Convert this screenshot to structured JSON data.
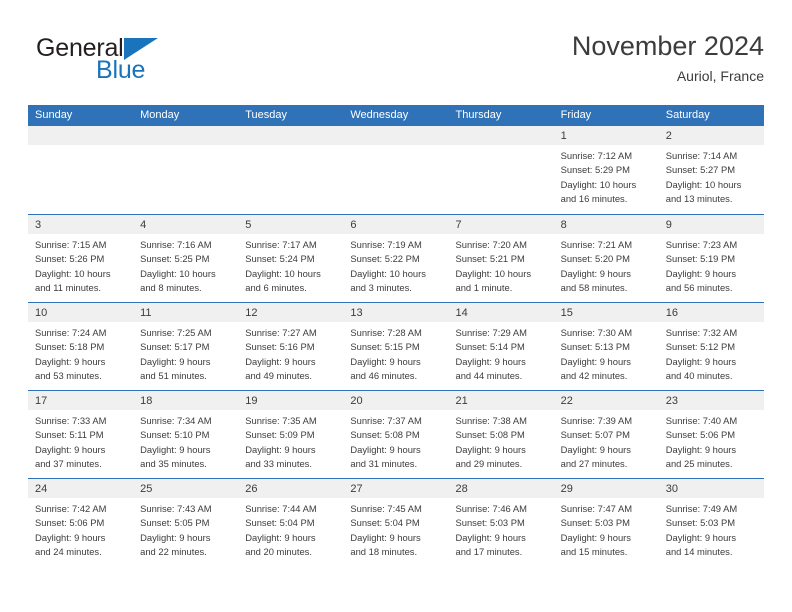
{
  "brand": {
    "name_part1": "General",
    "name_part2": "Blue",
    "triangle_icon": "triangle-icon",
    "accent_color": "#1a74bb"
  },
  "header": {
    "title": "November 2024",
    "subtitle": "Auriol, France"
  },
  "theme": {
    "header_blue": "#2f72b8",
    "band_gray": "#f0f0f0",
    "text": "#3c3c3c"
  },
  "weekdays": [
    "Sunday",
    "Monday",
    "Tuesday",
    "Wednesday",
    "Thursday",
    "Friday",
    "Saturday"
  ],
  "weeks": [
    [
      {
        "day": "",
        "lines": []
      },
      {
        "day": "",
        "lines": []
      },
      {
        "day": "",
        "lines": []
      },
      {
        "day": "",
        "lines": []
      },
      {
        "day": "",
        "lines": []
      },
      {
        "day": "1",
        "lines": [
          "Sunrise: 7:12 AM",
          "Sunset: 5:29 PM",
          "Daylight: 10 hours",
          "and 16 minutes."
        ]
      },
      {
        "day": "2",
        "lines": [
          "Sunrise: 7:14 AM",
          "Sunset: 5:27 PM",
          "Daylight: 10 hours",
          "and 13 minutes."
        ]
      }
    ],
    [
      {
        "day": "3",
        "lines": [
          "Sunrise: 7:15 AM",
          "Sunset: 5:26 PM",
          "Daylight: 10 hours",
          "and 11 minutes."
        ]
      },
      {
        "day": "4",
        "lines": [
          "Sunrise: 7:16 AM",
          "Sunset: 5:25 PM",
          "Daylight: 10 hours",
          "and 8 minutes."
        ]
      },
      {
        "day": "5",
        "lines": [
          "Sunrise: 7:17 AM",
          "Sunset: 5:24 PM",
          "Daylight: 10 hours",
          "and 6 minutes."
        ]
      },
      {
        "day": "6",
        "lines": [
          "Sunrise: 7:19 AM",
          "Sunset: 5:22 PM",
          "Daylight: 10 hours",
          "and 3 minutes."
        ]
      },
      {
        "day": "7",
        "lines": [
          "Sunrise: 7:20 AM",
          "Sunset: 5:21 PM",
          "Daylight: 10 hours",
          "and 1 minute."
        ]
      },
      {
        "day": "8",
        "lines": [
          "Sunrise: 7:21 AM",
          "Sunset: 5:20 PM",
          "Daylight: 9 hours",
          "and 58 minutes."
        ]
      },
      {
        "day": "9",
        "lines": [
          "Sunrise: 7:23 AM",
          "Sunset: 5:19 PM",
          "Daylight: 9 hours",
          "and 56 minutes."
        ]
      }
    ],
    [
      {
        "day": "10",
        "lines": [
          "Sunrise: 7:24 AM",
          "Sunset: 5:18 PM",
          "Daylight: 9 hours",
          "and 53 minutes."
        ]
      },
      {
        "day": "11",
        "lines": [
          "Sunrise: 7:25 AM",
          "Sunset: 5:17 PM",
          "Daylight: 9 hours",
          "and 51 minutes."
        ]
      },
      {
        "day": "12",
        "lines": [
          "Sunrise: 7:27 AM",
          "Sunset: 5:16 PM",
          "Daylight: 9 hours",
          "and 49 minutes."
        ]
      },
      {
        "day": "13",
        "lines": [
          "Sunrise: 7:28 AM",
          "Sunset: 5:15 PM",
          "Daylight: 9 hours",
          "and 46 minutes."
        ]
      },
      {
        "day": "14",
        "lines": [
          "Sunrise: 7:29 AM",
          "Sunset: 5:14 PM",
          "Daylight: 9 hours",
          "and 44 minutes."
        ]
      },
      {
        "day": "15",
        "lines": [
          "Sunrise: 7:30 AM",
          "Sunset: 5:13 PM",
          "Daylight: 9 hours",
          "and 42 minutes."
        ]
      },
      {
        "day": "16",
        "lines": [
          "Sunrise: 7:32 AM",
          "Sunset: 5:12 PM",
          "Daylight: 9 hours",
          "and 40 minutes."
        ]
      }
    ],
    [
      {
        "day": "17",
        "lines": [
          "Sunrise: 7:33 AM",
          "Sunset: 5:11 PM",
          "Daylight: 9 hours",
          "and 37 minutes."
        ]
      },
      {
        "day": "18",
        "lines": [
          "Sunrise: 7:34 AM",
          "Sunset: 5:10 PM",
          "Daylight: 9 hours",
          "and 35 minutes."
        ]
      },
      {
        "day": "19",
        "lines": [
          "Sunrise: 7:35 AM",
          "Sunset: 5:09 PM",
          "Daylight: 9 hours",
          "and 33 minutes."
        ]
      },
      {
        "day": "20",
        "lines": [
          "Sunrise: 7:37 AM",
          "Sunset: 5:08 PM",
          "Daylight: 9 hours",
          "and 31 minutes."
        ]
      },
      {
        "day": "21",
        "lines": [
          "Sunrise: 7:38 AM",
          "Sunset: 5:08 PM",
          "Daylight: 9 hours",
          "and 29 minutes."
        ]
      },
      {
        "day": "22",
        "lines": [
          "Sunrise: 7:39 AM",
          "Sunset: 5:07 PM",
          "Daylight: 9 hours",
          "and 27 minutes."
        ]
      },
      {
        "day": "23",
        "lines": [
          "Sunrise: 7:40 AM",
          "Sunset: 5:06 PM",
          "Daylight: 9 hours",
          "and 25 minutes."
        ]
      }
    ],
    [
      {
        "day": "24",
        "lines": [
          "Sunrise: 7:42 AM",
          "Sunset: 5:06 PM",
          "Daylight: 9 hours",
          "and 24 minutes."
        ]
      },
      {
        "day": "25",
        "lines": [
          "Sunrise: 7:43 AM",
          "Sunset: 5:05 PM",
          "Daylight: 9 hours",
          "and 22 minutes."
        ]
      },
      {
        "day": "26",
        "lines": [
          "Sunrise: 7:44 AM",
          "Sunset: 5:04 PM",
          "Daylight: 9 hours",
          "and 20 minutes."
        ]
      },
      {
        "day": "27",
        "lines": [
          "Sunrise: 7:45 AM",
          "Sunset: 5:04 PM",
          "Daylight: 9 hours",
          "and 18 minutes."
        ]
      },
      {
        "day": "28",
        "lines": [
          "Sunrise: 7:46 AM",
          "Sunset: 5:03 PM",
          "Daylight: 9 hours",
          "and 17 minutes."
        ]
      },
      {
        "day": "29",
        "lines": [
          "Sunrise: 7:47 AM",
          "Sunset: 5:03 PM",
          "Daylight: 9 hours",
          "and 15 minutes."
        ]
      },
      {
        "day": "30",
        "lines": [
          "Sunrise: 7:49 AM",
          "Sunset: 5:03 PM",
          "Daylight: 9 hours",
          "and 14 minutes."
        ]
      }
    ]
  ]
}
